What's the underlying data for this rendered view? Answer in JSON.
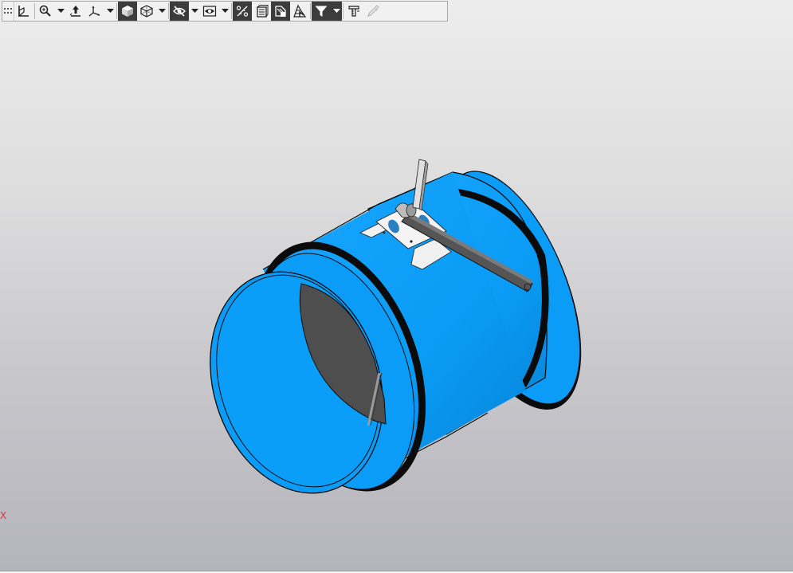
{
  "toolbar": {
    "buttons": [
      {
        "id": "grip",
        "icon": "grip-icon"
      },
      {
        "id": "orientation",
        "icon": "orientation-icon"
      },
      {
        "id": "zoom",
        "icon": "zoom-icon",
        "dropdown": true
      },
      {
        "id": "pan",
        "icon": "pan-icon"
      },
      {
        "id": "axes",
        "icon": "axes-icon",
        "dropdown": true
      },
      {
        "id": "shaded",
        "icon": "shaded-cube-icon",
        "pressed": true
      },
      {
        "id": "wireframe",
        "icon": "wireframe-cube-icon",
        "dropdown": true
      },
      {
        "id": "hide",
        "icon": "hide-eye-icon",
        "pressed": true,
        "dropdown": true
      },
      {
        "id": "show",
        "icon": "show-eye-icon",
        "dropdown": true
      },
      {
        "id": "constraints",
        "icon": "constraints-icon",
        "pressed": true
      },
      {
        "id": "section",
        "icon": "section-icon"
      },
      {
        "id": "display-components",
        "icon": "display-components-icon",
        "pressed": true
      },
      {
        "id": "perspective",
        "icon": "perspective-icon"
      },
      {
        "id": "filter",
        "icon": "filter-icon",
        "pressed": true,
        "dropdown": true
      },
      {
        "id": "measure",
        "icon": "measure-icon"
      },
      {
        "id": "pick",
        "icon": "pipette-icon",
        "disabled": true
      }
    ]
  },
  "viewport": {
    "axis_label": "X",
    "colors": {
      "part_blue": "#0a9cf6",
      "part_blue_dark": "#0678c4",
      "flange_black": "#0b0b0b",
      "damper_gray": "#4e4e4e",
      "bracket_white": "#f2f2f2",
      "axis_red": "#e0303a"
    }
  }
}
